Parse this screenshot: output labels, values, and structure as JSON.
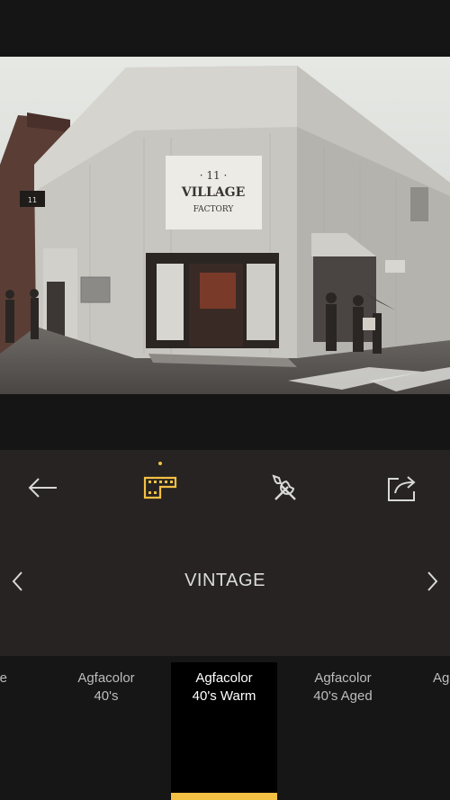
{
  "colors": {
    "accent": "#f2c043",
    "icon": "#d8d8d8",
    "bg_dark": "#161515",
    "panel": "#262322"
  },
  "photo": {
    "sign_line1": "· 11 ·",
    "sign_line2": "VILLAGE",
    "sign_line3": "FACTORY",
    "side_sign": "11"
  },
  "toolbar": {
    "back": "arrow-left-icon",
    "filters": "film-strip-icon",
    "tools": "tools-icon",
    "share": "share-icon"
  },
  "category": {
    "label": "VINTAGE"
  },
  "filters": [
    {
      "label": "e"
    },
    {
      "label": "Agfacolor\n40's"
    },
    {
      "label": "Agfacolor\n40's Warm",
      "selected": true
    },
    {
      "label": "Agfacolor\n40's Aged"
    },
    {
      "label": "Ag"
    }
  ]
}
